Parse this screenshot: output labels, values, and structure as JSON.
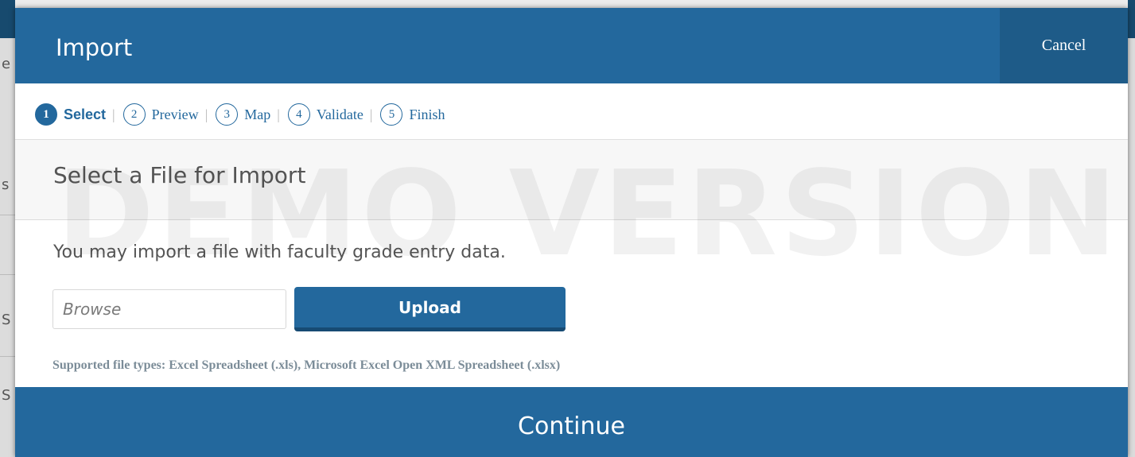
{
  "modal": {
    "title": "Import",
    "cancel_label": "Cancel"
  },
  "steps": [
    {
      "number": "1",
      "label": "Select",
      "active": true
    },
    {
      "number": "2",
      "label": "Preview",
      "active": false
    },
    {
      "number": "3",
      "label": "Map",
      "active": false
    },
    {
      "number": "4",
      "label": "Validate",
      "active": false
    },
    {
      "number": "5",
      "label": "Finish",
      "active": false
    }
  ],
  "step_separator": "|",
  "section": {
    "title": "Select a File for Import"
  },
  "content": {
    "instruction": "You may import a file with faculty grade entry data.",
    "browse_placeholder": "Browse",
    "upload_label": "Upload",
    "supported_types": "Supported file types: Excel Spreadsheet (.xls), Microsoft Excel Open XML Spreadsheet (.xlsx)"
  },
  "footer": {
    "continue_label": "Continue"
  },
  "watermark": "DEMO VERSION",
  "background_fragments": [
    "e",
    "s",
    "S",
    "S"
  ],
  "colors": {
    "primary": "#23689d",
    "primary_dark": "#1e5b88",
    "text_muted": "#555555",
    "supported_text": "#7b8c98"
  }
}
